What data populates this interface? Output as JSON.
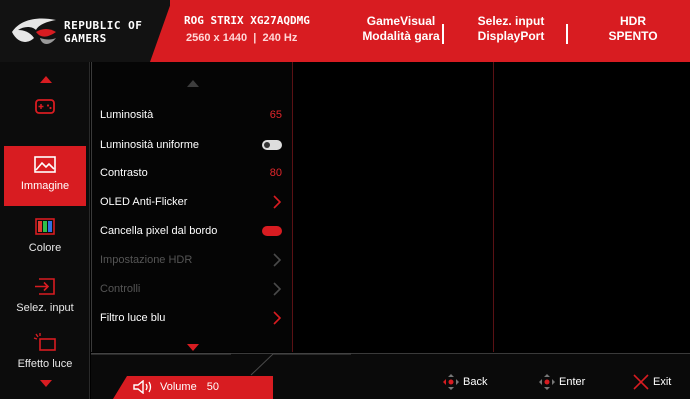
{
  "header": {
    "brand_line1": "REPUBLIC OF",
    "brand_line2": "GAMERS",
    "model": "ROG STRIX XG27AQDMG",
    "resolution": "2560 x 1440",
    "refresh": "240 Hz",
    "gamevisual_label": "GameVisual",
    "gamevisual_value": "Modalità gara",
    "input_label": "Selez. input",
    "input_value": "DisplayPort",
    "hdr_label": "HDR",
    "hdr_value": "SPENTO"
  },
  "nav": {
    "items": [
      {
        "label": "",
        "icon": "gamepad-icon"
      },
      {
        "label": "Immagine",
        "icon": "image-icon",
        "active": true
      },
      {
        "label": "Colore",
        "icon": "color-bars-icon"
      },
      {
        "label": "Selez. input",
        "icon": "input-icon"
      },
      {
        "label": "Effetto luce",
        "icon": "light-effect-icon"
      }
    ]
  },
  "menu": {
    "items": [
      {
        "label": "Luminosità",
        "value": "65",
        "control": "value"
      },
      {
        "label": "Luminosità uniforme",
        "control": "toggle-off"
      },
      {
        "label": "Contrasto",
        "value": "80",
        "control": "value"
      },
      {
        "label": "OLED Anti-Flicker",
        "control": "chevron"
      },
      {
        "label": "Cancella pixel dal bordo",
        "control": "toggle-on"
      },
      {
        "label": "Impostazione HDR",
        "control": "chevron",
        "disabled": true
      },
      {
        "label": "Controlli",
        "control": "chevron",
        "disabled": true
      },
      {
        "label": "Filtro luce blu",
        "control": "chevron"
      }
    ]
  },
  "footer": {
    "volume_label": "Volume",
    "volume_value": "50",
    "back_label": "Back",
    "enter_label": "Enter",
    "exit_label": "Exit"
  },
  "colors": {
    "accent": "#d81c21",
    "value_red": "#e3262b",
    "disabled_text": "#555555"
  }
}
